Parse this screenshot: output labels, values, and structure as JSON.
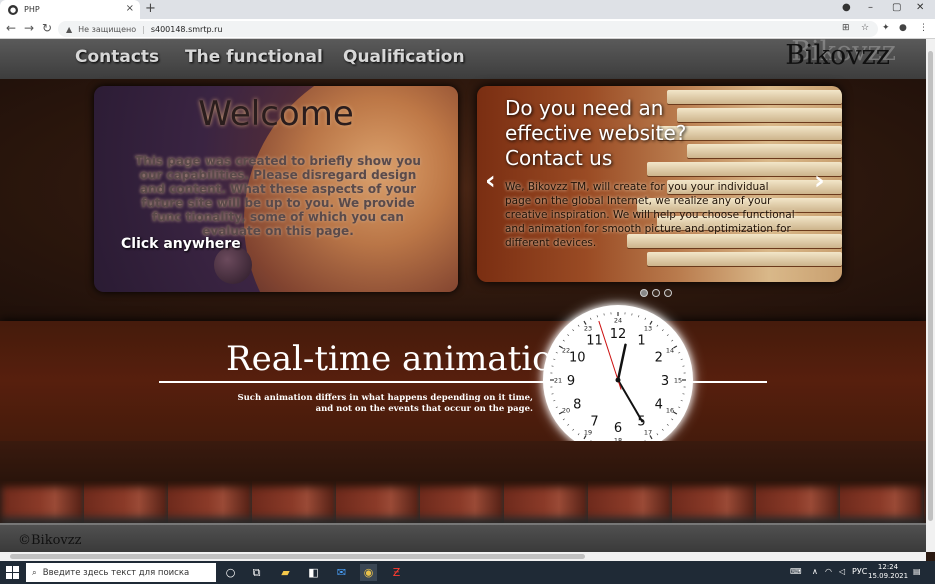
{
  "browser": {
    "tab_title": "PHP",
    "tab_close": "×",
    "new_tab": "+",
    "security_label": "Не защищено",
    "url": "s400148.smrtp.ru"
  },
  "site": {
    "nav": {
      "items": [
        "Contacts",
        "The functional",
        "Qualification"
      ],
      "logo": "Bikovzz"
    },
    "welcome": {
      "title": "Welcome",
      "text": "This page was created to briefly show you our capabilities. Please disregard design and content. What these aspects of your future site will be up to you. We provide func tionality, some of which you can evaluate on this page.",
      "cta": "Click anywhere"
    },
    "slider": {
      "title": "Do you need an effective website? Contact us",
      "text": "We, Bikovzz TM, will create for you your individual page on the global Internet, we realize any of your creative inspiration. We will help you choose functional and animation for smooth picture and optimization for different devices.",
      "prev": "‹",
      "next": "›",
      "active_slide": 1,
      "slide_count": 3
    },
    "animation": {
      "title": "Real-time animation",
      "text": "Such animation differs in what happens depending on it time, and not on the events that occur on the page."
    },
    "clock": {
      "outer_numbers": [
        "1",
        "2",
        "3",
        "4",
        "5",
        "6",
        "7",
        "8",
        "9",
        "10",
        "11",
        "12"
      ],
      "inner_numbers": [
        "13",
        "14",
        "15",
        "16",
        "17",
        "18",
        "19",
        "20",
        "21",
        "22",
        "23",
        "24"
      ],
      "hour": 0,
      "minute": 24,
      "second": 57,
      "second_hand_color": "#cc1111"
    },
    "footer": {
      "copyright": "©Bikovzz"
    }
  },
  "taskbar": {
    "search_placeholder": "Введите здесь текст для поиска",
    "language": "РУС",
    "time": "12:24",
    "date": "15.09.2021"
  },
  "colors": {
    "accent_red": "#cc1111",
    "nav_text": "#d7d7d7"
  }
}
